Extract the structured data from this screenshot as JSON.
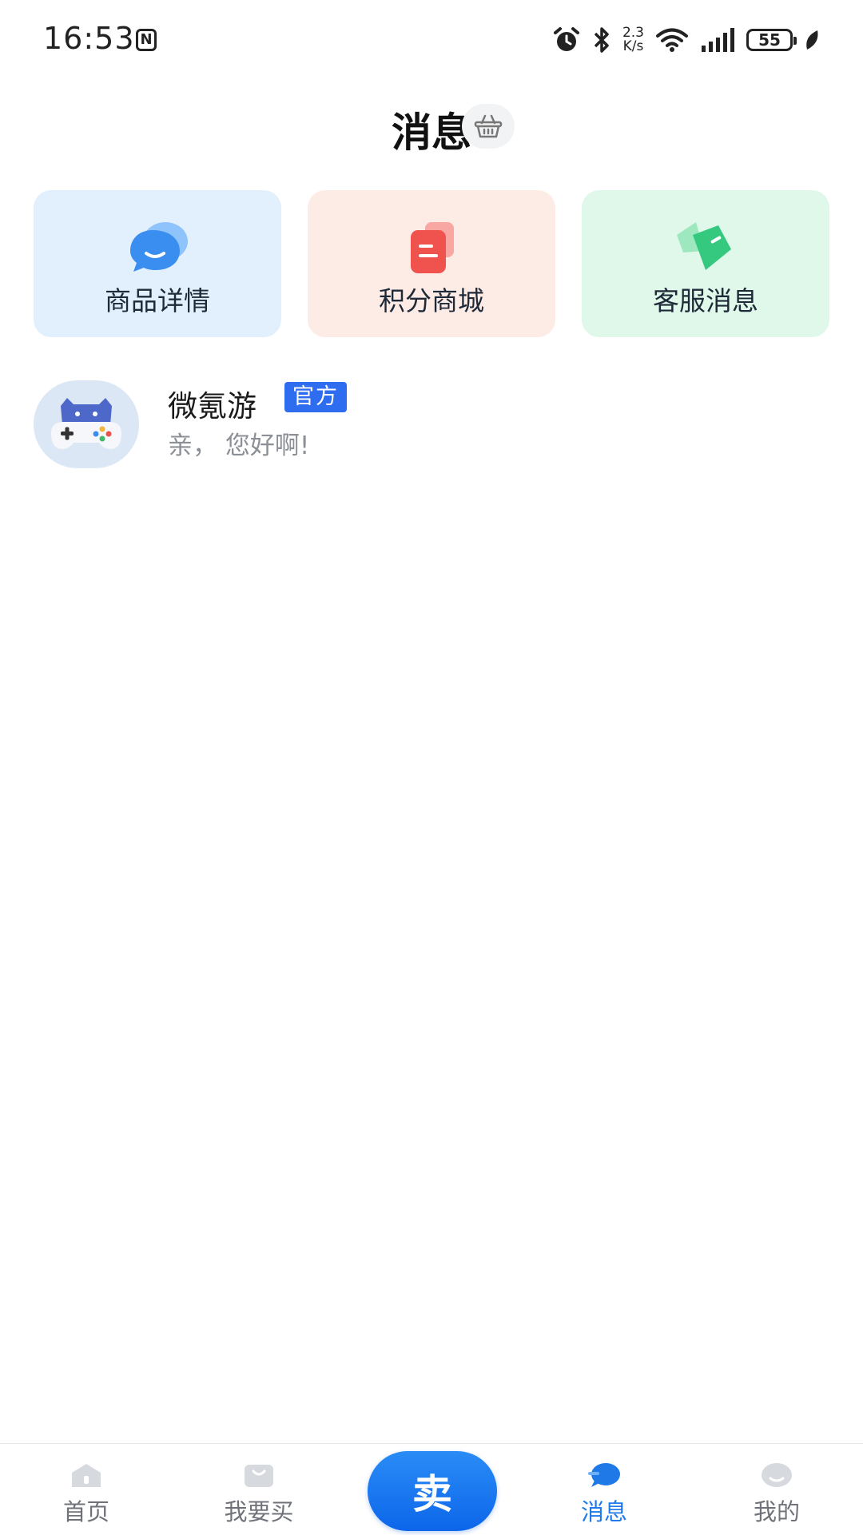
{
  "status_bar": {
    "time": "16:53",
    "nfc_glyph": "N",
    "speed_value": "2.3",
    "speed_unit": "K/s",
    "battery": "55"
  },
  "header": {
    "title": "消息"
  },
  "quick_cards": [
    {
      "label": "商品详情",
      "icon": "chat-bubble-icon",
      "color": "#3a8ef0"
    },
    {
      "label": "积分商城",
      "icon": "document-icon",
      "color": "#f0524d"
    },
    {
      "label": "客服消息",
      "icon": "megaphone-icon",
      "color": "#34c97f"
    }
  ],
  "messages": [
    {
      "name": "微氪游",
      "badge": "官方",
      "preview": "亲， 您好啊!"
    }
  ],
  "tab_bar": {
    "tabs": [
      {
        "label": "首页",
        "icon": "home-icon",
        "active": false
      },
      {
        "label": "我要买",
        "icon": "shopping-bag-icon",
        "active": false
      },
      {
        "label": "消息",
        "icon": "message-icon",
        "active": true
      },
      {
        "label": "我的",
        "icon": "profile-icon",
        "active": false
      }
    ],
    "sell_label": "卖"
  },
  "colors": {
    "accent": "#1f7ae8",
    "badge": "#2f6df0",
    "sell_button": "#0d66ea"
  }
}
